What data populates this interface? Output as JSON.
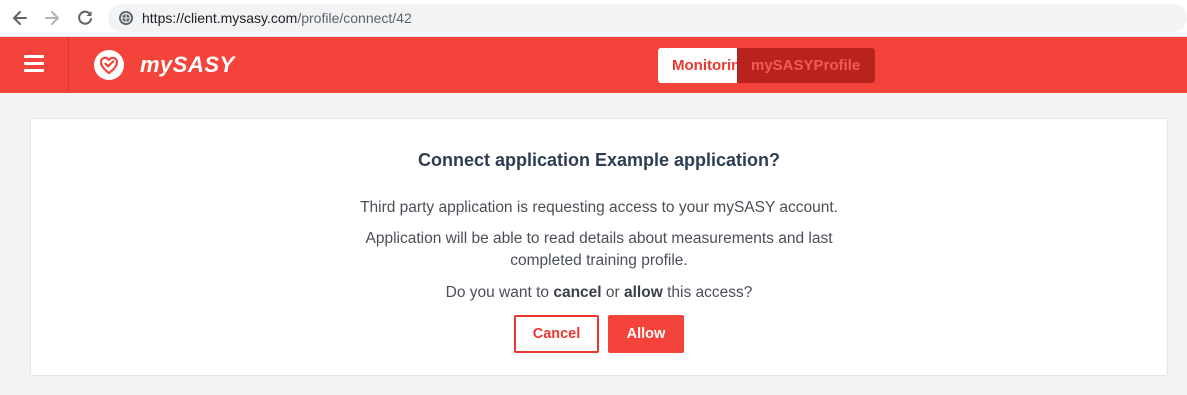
{
  "browser": {
    "url_host": "https://client.mysasy.com",
    "url_path": "/profile/connect/42"
  },
  "header": {
    "brand": "mySASY",
    "tabs": [
      {
        "label": "Monitoring",
        "active": true
      },
      {
        "label": "mySASYProfile",
        "active": false
      }
    ],
    "colors": {
      "accent": "#f4433b",
      "inactive_tab": "#b8241d"
    }
  },
  "dialog": {
    "title": "Connect application Example application?",
    "line1": "Third party application is requesting access to your mySASY account.",
    "line2a": "Application will be able to read details about measurements and last",
    "line2b": "completed training profile.",
    "question_prefix": "Do you want to ",
    "question_cancel": "cancel",
    "question_or": " or ",
    "question_allow": "allow",
    "question_suffix": " this access?",
    "cancel_label": "Cancel",
    "allow_label": "Allow"
  }
}
